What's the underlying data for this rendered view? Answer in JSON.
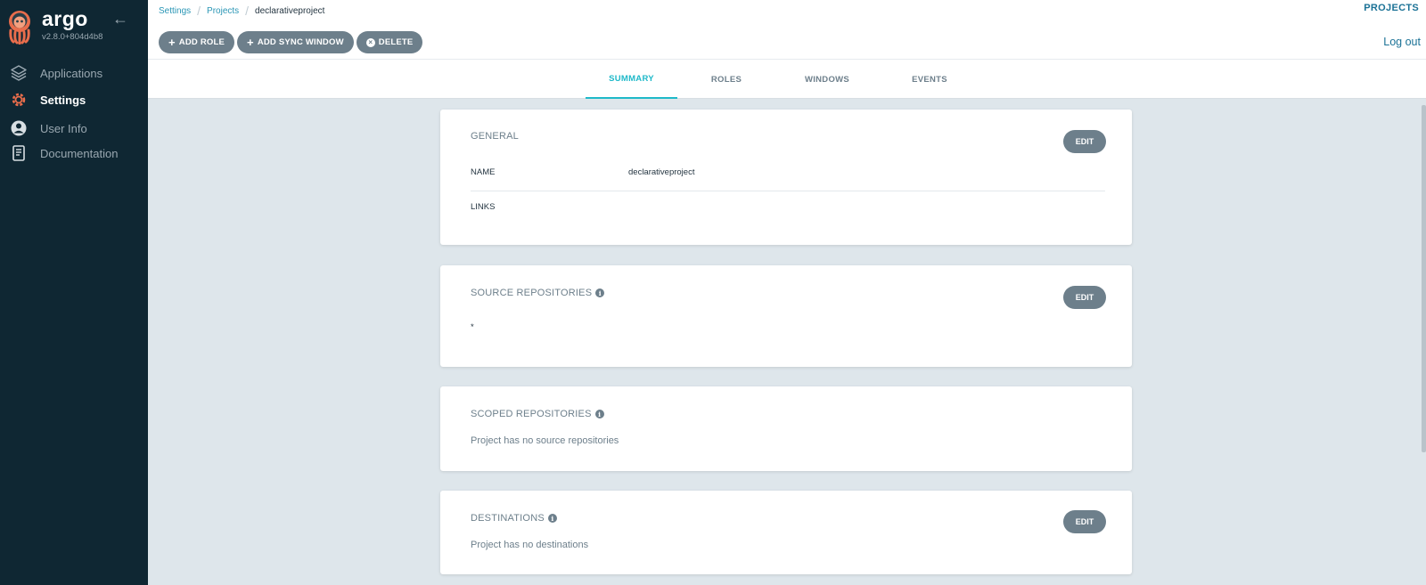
{
  "app": {
    "name": "argo",
    "version": "v2.8.0+804d4b8"
  },
  "sidebar": {
    "items": [
      {
        "label": "Applications",
        "icon": "layers-icon",
        "active": false
      },
      {
        "label": "Settings",
        "icon": "gear-icon",
        "active": true
      },
      {
        "label": "User Info",
        "icon": "user-circle-icon",
        "active": false
      },
      {
        "label": "Documentation",
        "icon": "book-icon",
        "active": false
      }
    ]
  },
  "breadcrumb": {
    "items": [
      "Settings",
      "Projects"
    ],
    "current": "declarativeproject"
  },
  "header": {
    "projects_link": "PROJECTS",
    "logout": "Log out"
  },
  "actions": {
    "add_role": "ADD ROLE",
    "add_sync_window": "ADD SYNC WINDOW",
    "delete": "DELETE"
  },
  "tabs": [
    {
      "label": "SUMMARY",
      "active": true
    },
    {
      "label": "ROLES",
      "active": false
    },
    {
      "label": "WINDOWS",
      "active": false
    },
    {
      "label": "EVENTS",
      "active": false
    }
  ],
  "cards": {
    "general": {
      "title": "GENERAL",
      "edit": "EDIT",
      "name_label": "NAME",
      "name_value": "declarativeproject",
      "links_label": "LINKS"
    },
    "source_repositories": {
      "title": "SOURCE REPOSITORIES",
      "edit": "EDIT",
      "items": [
        "*"
      ]
    },
    "scoped_repositories": {
      "title": "SCOPED REPOSITORIES",
      "empty_text": "Project has no source repositories"
    },
    "destinations": {
      "title": "DESTINATIONS",
      "edit": "EDIT",
      "empty_text": "Project has no destinations"
    }
  },
  "colors": {
    "sidebar_bg": "#0f2733",
    "accent": "#1fb9c9",
    "link": "#1b7296",
    "button_bg": "#6d7f8b",
    "logo_orange": "#e96d4c"
  }
}
